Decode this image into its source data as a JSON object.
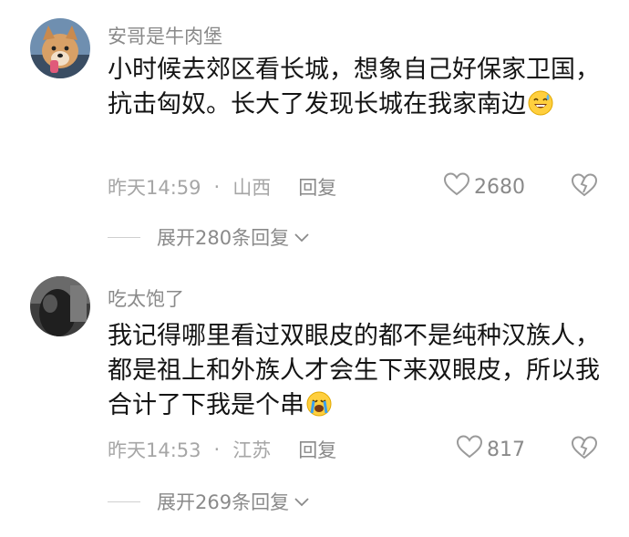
{
  "comments": [
    {
      "username": "安哥是牛肉堡",
      "text": "小时候去郊区看长城，想象自己好保家卫国，抗击匈奴。长大了发现长城在我家南边",
      "emoji": "sweat-smile-emoji",
      "time": "昨天14:59",
      "separator": "·",
      "location": "山西",
      "reply_label": "回复",
      "likes": "2680",
      "expand_label": "展开280条回复"
    },
    {
      "username": "吃太饱了",
      "text": "我记得哪里看过双眼皮的都不是纯种汉族人，都是祖上和外族人才会生下来双眼皮，所以我合计了下我是个串",
      "emoji": "crying-emoji",
      "time": "昨天14:53",
      "separator": "·",
      "location": "江苏",
      "reply_label": "回复",
      "likes": "817",
      "expand_label": "展开269条回复"
    }
  ]
}
